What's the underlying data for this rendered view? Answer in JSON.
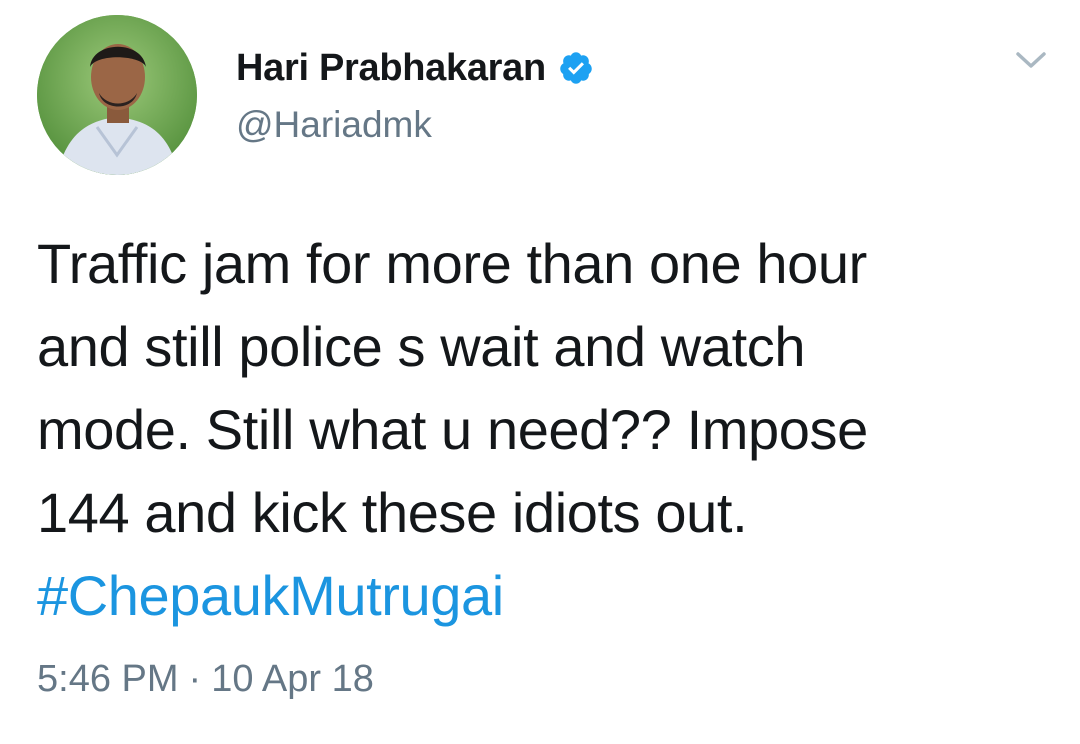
{
  "author": {
    "display_name": "Hari Prabhakaran",
    "handle": "@Hariadmk",
    "verified": true,
    "avatar_icon": "profile-photo"
  },
  "tweet": {
    "lines": [
      "Traffic jam for more than one hour",
      "and still police s wait and watch",
      "mode. Still what u need?? Impose",
      "144 and kick these idiots out."
    ],
    "hashtag": "#ChepaukMutrugai",
    "time": "5:46 PM",
    "separator": "·",
    "date": "10 Apr 18"
  },
  "colors": {
    "text": "#14171a",
    "secondary": "#657786",
    "link": "#1b95e0",
    "verified_badge": "#1da1f2"
  },
  "icons": {
    "verified": "verified-badge-icon",
    "menu": "chevron-down-icon"
  }
}
